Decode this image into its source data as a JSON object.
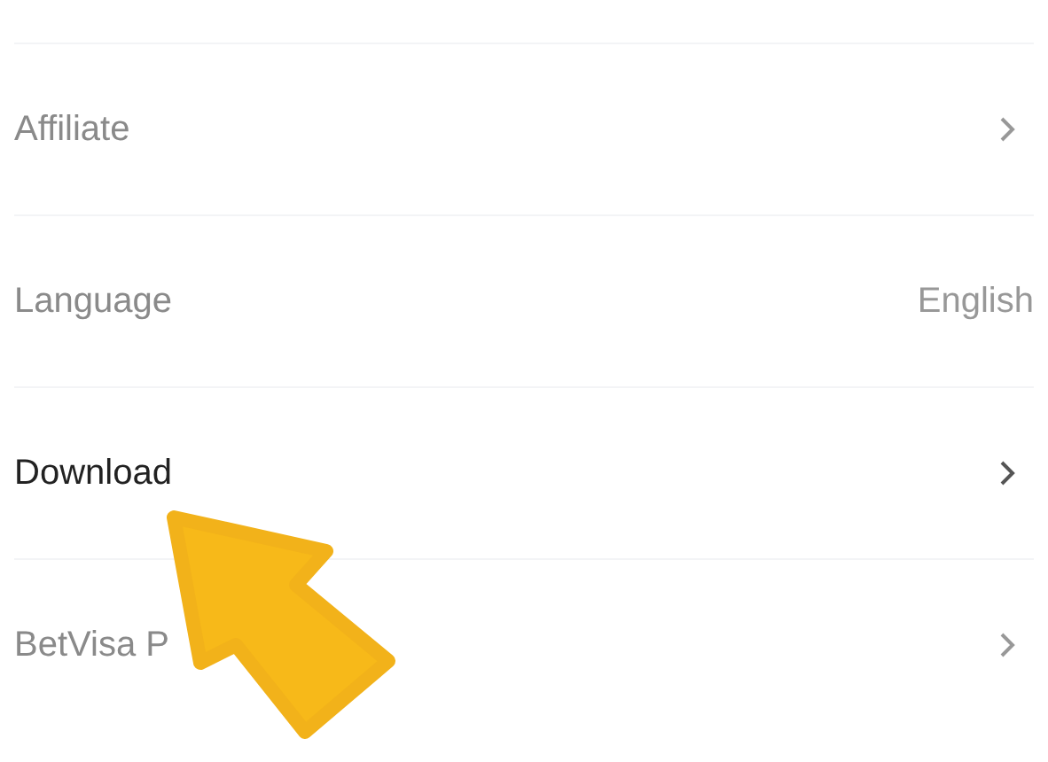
{
  "settings": [
    {
      "label": "Affiliate",
      "kind": "chevron",
      "blurred": true
    },
    {
      "label": "Language",
      "kind": "value",
      "value": "English",
      "blurred": true
    },
    {
      "label": "Download",
      "kind": "chevron",
      "blurred": false
    },
    {
      "label": "BetVisa P",
      "kind": "chevron",
      "blurred": true
    }
  ]
}
